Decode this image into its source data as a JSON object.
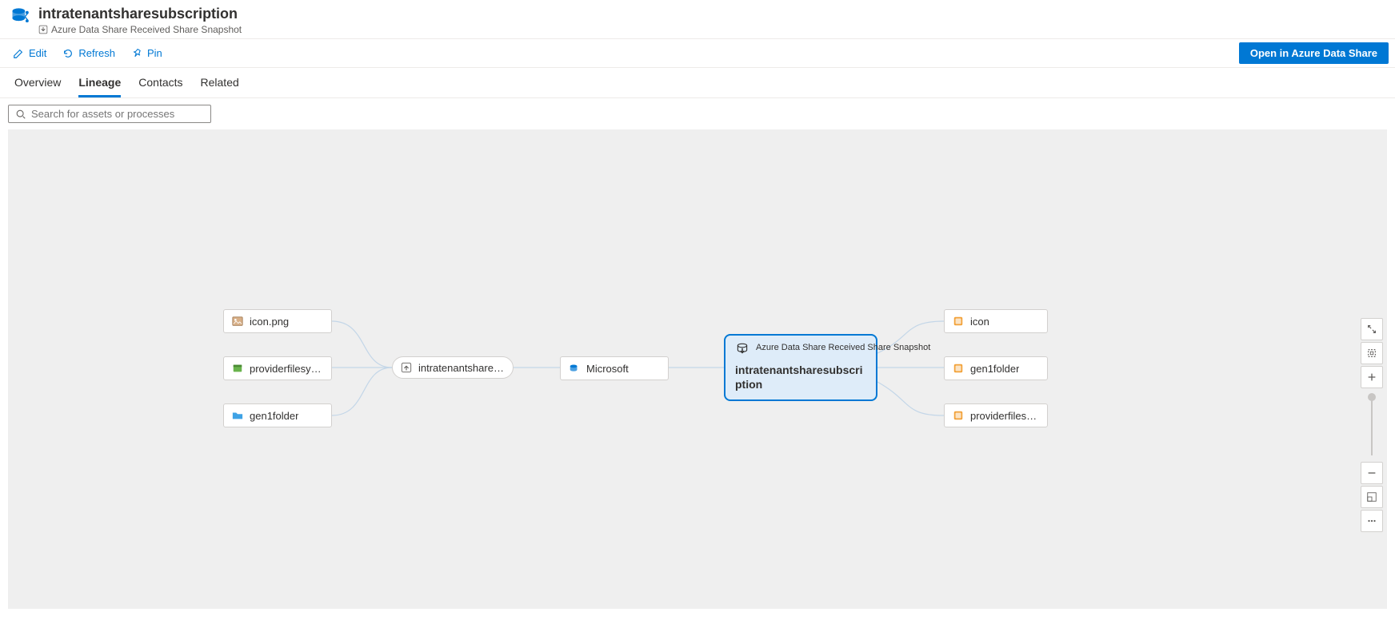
{
  "header": {
    "title": "intratenantsharesubscription",
    "subtitle": "Azure Data Share Received Share Snapshot"
  },
  "toolbar": {
    "edit": "Edit",
    "refresh": "Refresh",
    "pin": "Pin",
    "open": "Open in Azure Data Share"
  },
  "tabs": {
    "overview": "Overview",
    "lineage": "Lineage",
    "contacts": "Contacts",
    "related": "Related"
  },
  "search": {
    "placeholder": "Search for assets or processes"
  },
  "nodes": {
    "left": [
      {
        "label": "icon.png"
      },
      {
        "label": "providerfilesystem"
      },
      {
        "label": "gen1folder"
      }
    ],
    "pill": {
      "label": "intratenantshare_Mi..."
    },
    "mid": {
      "label": "Microsoft"
    },
    "selected": {
      "subtitle": "Azure Data Share Received Share Snapshot",
      "title": "intratenantsharesubscription"
    },
    "right": [
      {
        "label": "icon"
      },
      {
        "label": "gen1folder"
      },
      {
        "label": "providerfilesystem"
      }
    ]
  }
}
